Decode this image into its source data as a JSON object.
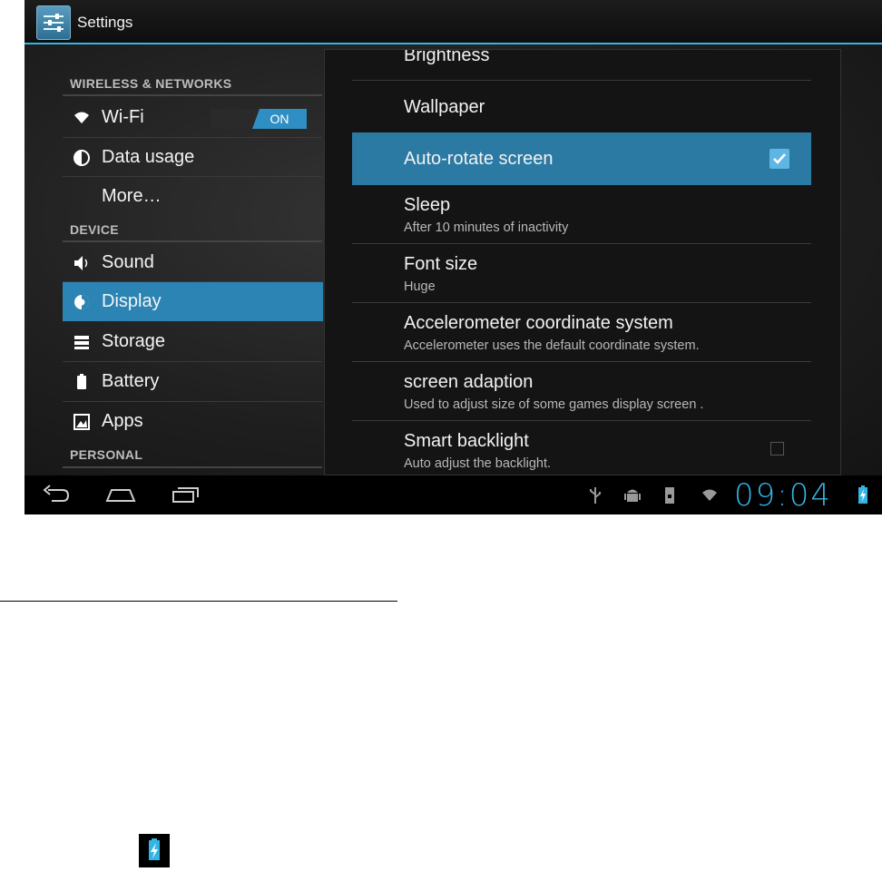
{
  "app": {
    "title": "Settings"
  },
  "sidebar": {
    "headers": [
      "WIRELESS & NETWORKS",
      "DEVICE",
      "PERSONAL"
    ],
    "items": [
      {
        "label": "Wi-Fi",
        "icon": "wifi-icon"
      },
      {
        "label": "Data usage",
        "icon": "data-usage-icon"
      },
      {
        "label": "More…",
        "icon": ""
      },
      {
        "label": "Sound",
        "icon": "speaker-icon"
      },
      {
        "label": "Display",
        "icon": "display-brightness-icon",
        "selected": true
      },
      {
        "label": "Storage",
        "icon": "storage-icon"
      },
      {
        "label": "Battery",
        "icon": "battery-icon"
      },
      {
        "label": "Apps",
        "icon": "apps-icon"
      }
    ],
    "wifi_toggle": "ON"
  },
  "display_prefs": [
    {
      "title": "Brightness",
      "summary": ""
    },
    {
      "title": "Wallpaper",
      "summary": ""
    },
    {
      "title": "Auto-rotate screen",
      "summary": "",
      "checked": true
    },
    {
      "title": "Sleep",
      "summary": "After 10 minutes of inactivity"
    },
    {
      "title": "Font size",
      "summary": "Huge"
    },
    {
      "title": "Accelerometer coordinate system",
      "summary": "Accelerometer uses the default coordinate system."
    },
    {
      "title": "screen adaption",
      "summary": "Used to adjust size of some games display screen ."
    },
    {
      "title": "Smart backlight",
      "summary": "Auto adjust the backlight.",
      "checked": false
    }
  ],
  "statusbar": {
    "time": "09:04"
  },
  "colors": {
    "accent": "#33b5e5",
    "selected": "#2b84b3"
  }
}
